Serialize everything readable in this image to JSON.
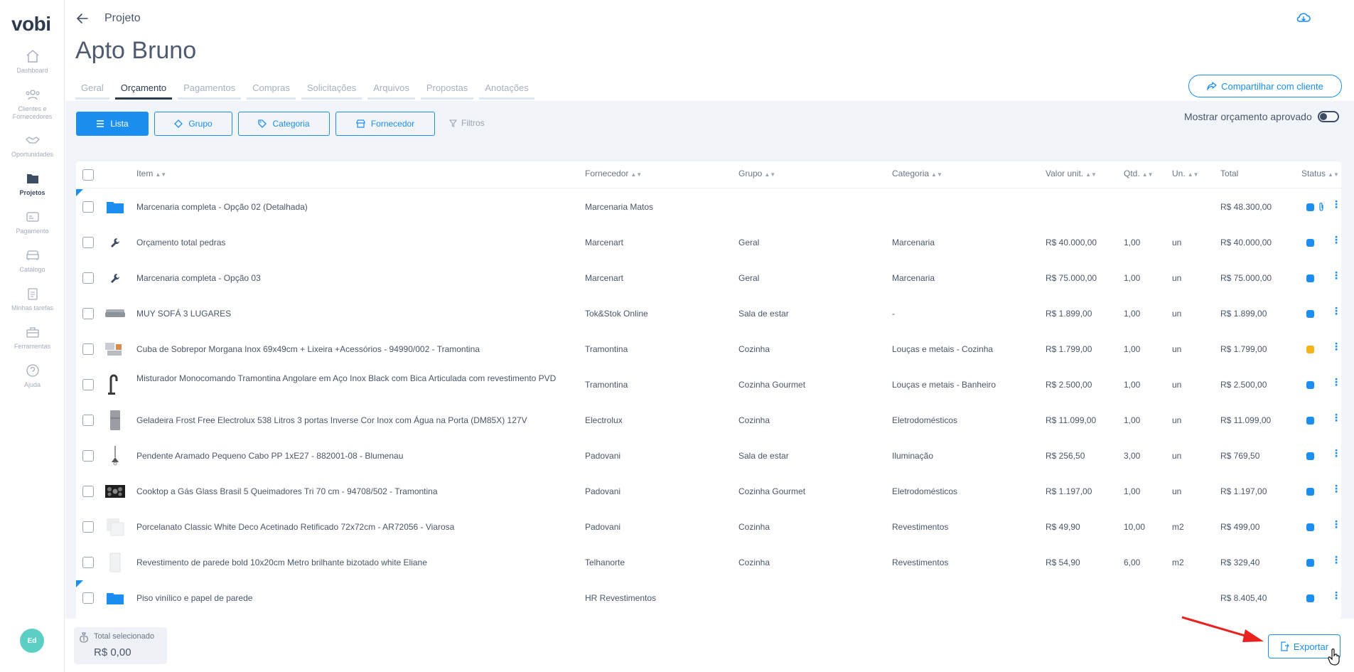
{
  "sidebar": {
    "logo": "vobi",
    "items": [
      {
        "label": "Dashboard",
        "icon": "home-icon"
      },
      {
        "label": "Clientes e Fornecedores",
        "icon": "users-icon"
      },
      {
        "label": "Oportunidades",
        "icon": "handshake-icon"
      },
      {
        "label": "Projetos",
        "icon": "folder-icon",
        "active": true
      },
      {
        "label": "Pagamento",
        "icon": "payment-icon"
      },
      {
        "label": "Catálogo",
        "icon": "sofa-icon"
      },
      {
        "label": "Minhas tarefas",
        "icon": "clipboard-icon"
      },
      {
        "label": "Ferramentas",
        "icon": "toolbox-icon"
      },
      {
        "label": "Ajuda",
        "icon": "help-icon"
      }
    ],
    "avatar": "Ed"
  },
  "header": {
    "breadcrumb": "Projeto",
    "title": "Apto Bruno",
    "share_label": "Compartilhar com cliente"
  },
  "tabs": [
    "Geral",
    "Orçamento",
    "Pagamentos",
    "Compras",
    "Solicitações",
    "Arquivos",
    "Propostas",
    "Anotações"
  ],
  "active_tab": "Orçamento",
  "filters": {
    "lista": "Lista",
    "grupo": "Grupo",
    "categoria": "Categoria",
    "fornecedor": "Fornecedor",
    "filtros": "Filtros",
    "approved_toggle": "Mostrar orçamento aprovado"
  },
  "table": {
    "columns": {
      "item": "Item",
      "fornecedor": "Fornecedor",
      "grupo": "Grupo",
      "categoria": "Categoria",
      "valor": "Valor unit.",
      "qtd": "Qtd.",
      "un": "Un.",
      "total": "Total",
      "status": "Status"
    },
    "rows": [
      {
        "item": "Marcenaria completa - Opção 02 (Detalhada)",
        "fornecedor": "Marcenaria Matos",
        "grupo": "",
        "categoria": "",
        "valor": "",
        "qtd": "",
        "un": "",
        "total": "R$ 48.300,00",
        "thumb": "folder-icon",
        "status": "#1b8ef0",
        "attach": true,
        "group": true
      },
      {
        "item": "Orçamento total pedras",
        "fornecedor": "Marcenart",
        "grupo": "Geral",
        "categoria": "Marcenaria",
        "valor": "R$ 40.000,00",
        "qtd": "1,00",
        "un": "un",
        "total": "R$ 40.000,00",
        "thumb": "wrench-icon",
        "status": "#1b8ef0"
      },
      {
        "item": "Marcenaria completa - Opção 03",
        "fornecedor": "Marcenart",
        "grupo": "Geral",
        "categoria": "Marcenaria",
        "valor": "R$ 75.000,00",
        "qtd": "1,00",
        "un": "un",
        "total": "R$ 75.000,00",
        "thumb": "wrench-icon",
        "status": "#1b8ef0"
      },
      {
        "item": "MUY SOFÁ 3 LUGARES",
        "fornecedor": "Tok&Stok Online",
        "grupo": "Sala de estar",
        "categoria": "-",
        "valor": "R$ 1.899,00",
        "qtd": "1,00",
        "un": "un",
        "total": "R$ 1.899,00",
        "thumb": "sofa-photo",
        "status": "#1b8ef0"
      },
      {
        "item": "Cuba de Sobrepor Morgana Inox 69x49cm + Lixeira +Acessórios - 94990/002 - Tramontina",
        "fornecedor": "Tramontina",
        "grupo": "Cozinha",
        "categoria": "Louças e metais - Cozinha",
        "valor": "R$ 1.799,00",
        "qtd": "1,00",
        "un": "un",
        "total": "R$ 1.799,00",
        "thumb": "sink-photo",
        "status": "#f5b21b"
      },
      {
        "item": "Misturador Monocomando Tramontina Angolare em Aço Inox Black com Bica Articulada com revestimento PVD",
        "fornecedor": "Tramontina",
        "grupo": "Cozinha Gourmet",
        "categoria": "Louças e metais - Banheiro",
        "valor": "R$ 2.500,00",
        "qtd": "1,00",
        "un": "un",
        "total": "R$ 2.500,00",
        "thumb": "faucet-photo",
        "status": "#1b8ef0",
        "wrap": true
      },
      {
        "item": "Geladeira Frost Free Electrolux 538 Litros 3 portas Inverse Cor Inox com Água na Porta (DM85X) 127V",
        "fornecedor": "Electrolux",
        "grupo": "Cozinha",
        "categoria": "Eletrodomésticos",
        "valor": "R$ 11.099,00",
        "qtd": "1,00",
        "un": "un",
        "total": "R$ 11.099,00",
        "thumb": "fridge-photo",
        "status": "#1b8ef0"
      },
      {
        "item": "Pendente Aramado Pequeno Cabo PP 1xE27 - 882001-08 - Blumenau",
        "fornecedor": "Padovani",
        "grupo": "Sala de estar",
        "categoria": "Iluminação",
        "valor": "R$ 256,50",
        "qtd": "3,00",
        "un": "un",
        "total": "R$ 769,50",
        "thumb": "lamp-photo",
        "status": "#1b8ef0"
      },
      {
        "item": "Cooktop a Gás Glass Brasil 5 Queimadores Tri 70 cm - 94708/502 - Tramontina",
        "fornecedor": "Padovani",
        "grupo": "Cozinha Gourmet",
        "categoria": "Eletrodomésticos",
        "valor": "R$ 1.197,00",
        "qtd": "1,00",
        "un": "un",
        "total": "R$ 1.197,00",
        "thumb": "cooktop-photo",
        "status": "#1b8ef0"
      },
      {
        "item": "Porcelanato Classic White Deco Acetinado Retificado 72x72cm - AR72056 - Viarosa",
        "fornecedor": "Padovani",
        "grupo": "Cozinha",
        "categoria": "Revestimentos",
        "valor": "R$ 49,90",
        "qtd": "10,00",
        "un": "m2",
        "total": "R$ 499,00",
        "thumb": "tile-photo",
        "status": "#1b8ef0"
      },
      {
        "item": "Revestimento de parede bold 10x20cm Metro brilhante bizotado white Eliane",
        "fornecedor": "Telhanorte",
        "grupo": "Cozinha",
        "categoria": "Revestimentos",
        "valor": "R$ 54,90",
        "qtd": "6,00",
        "un": "m2",
        "total": "R$ 329,40",
        "thumb": "wall-tile-photo",
        "status": "#1b8ef0"
      },
      {
        "item": "Piso vinílico e papel de parede",
        "fornecedor": "HR Revestimentos",
        "grupo": "",
        "categoria": "",
        "valor": "",
        "qtd": "",
        "un": "",
        "total": "R$ 8.405,40",
        "thumb": "folder-icon",
        "status": "#1b8ef0",
        "group": true
      }
    ]
  },
  "footer": {
    "total_label": "Total selecionado",
    "total_value": "R$ 0,00",
    "export_label": "Exportar"
  },
  "colors": {
    "accent": "#1b8ef0",
    "warning": "#f5b21b",
    "annotation_arrow": "#e8231f"
  }
}
